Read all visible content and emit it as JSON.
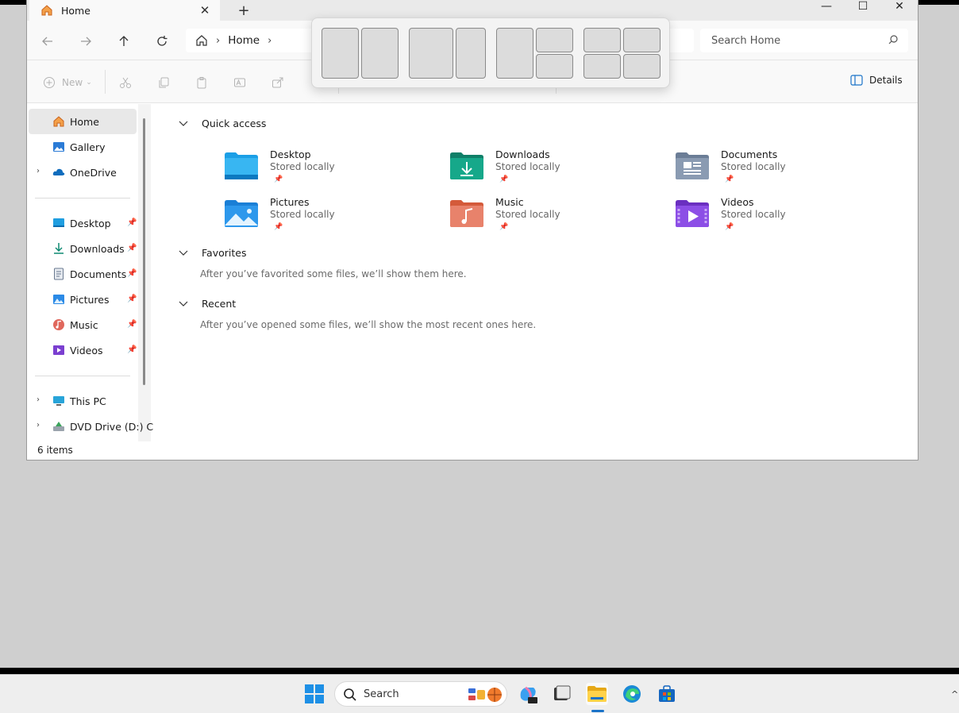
{
  "window": {
    "tab_title": "Home",
    "tab_close": "✕",
    "new_tab": "+",
    "minimize": "—",
    "maximize": "☐",
    "close": "✕"
  },
  "address": {
    "breadcrumb_home": "Home",
    "search_placeholder": "Search Home"
  },
  "toolbar": {
    "new_label": "New",
    "details_label": "Details"
  },
  "sidebar": {
    "home": "Home",
    "gallery": "Gallery",
    "onedrive": "OneDrive",
    "desktop": "Desktop",
    "downloads": "Downloads",
    "documents": "Documents",
    "pictures": "Pictures",
    "music": "Music",
    "videos": "Videos",
    "this_pc": "This PC",
    "dvd_drive": "DVD Drive (D:) C"
  },
  "status": {
    "item_count": "6 items"
  },
  "quick_access": {
    "title": "Quick access",
    "items": [
      {
        "name": "Desktop",
        "sub": "Stored locally",
        "icon": "desktop-folder-icon"
      },
      {
        "name": "Downloads",
        "sub": "Stored locally",
        "icon": "downloads-folder-icon"
      },
      {
        "name": "Documents",
        "sub": "Stored locally",
        "icon": "documents-folder-icon"
      },
      {
        "name": "Pictures",
        "sub": "Stored locally",
        "icon": "pictures-folder-icon"
      },
      {
        "name": "Music",
        "sub": "Stored locally",
        "icon": "music-folder-icon"
      },
      {
        "name": "Videos",
        "sub": "Stored locally",
        "icon": "videos-folder-icon"
      }
    ]
  },
  "favorites": {
    "title": "Favorites",
    "empty": "After you’ve favorited some files, we’ll show them here."
  },
  "recent": {
    "title": "Recent",
    "empty": "After you’ve opened some files, we’ll show the most recent ones here."
  },
  "taskbar": {
    "search_label": "Search"
  },
  "colors": {
    "accent": "#1a73c8",
    "window_bg": "#ffffff",
    "chrome_bg": "#f9f9f9",
    "desktop_bg": "#cfcfcf"
  }
}
